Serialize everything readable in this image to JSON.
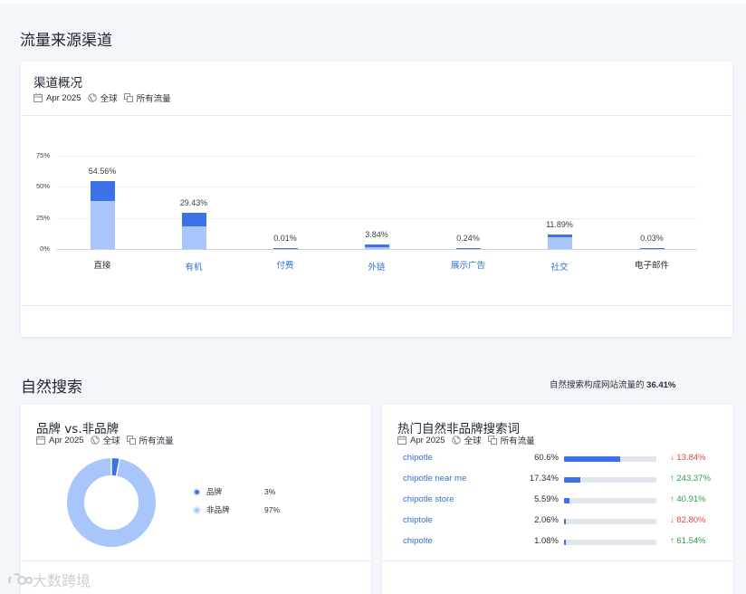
{
  "traffic": {
    "section_title": "流量来源渠道",
    "card_title": "渠道概况",
    "meta": {
      "date": "Apr 2025",
      "region": "全球",
      "traffic_type": "所有流量"
    },
    "chart_data": {
      "type": "bar",
      "stacked": true,
      "y_ticks": [
        "75%",
        "50%",
        "25%",
        "0%"
      ],
      "ylim": [
        0,
        75
      ],
      "categories": [
        "直接",
        "有机",
        "付费",
        "外链",
        "展示广告",
        "社交",
        "电子邮件"
      ],
      "category_link_style": [
        false,
        true,
        true,
        true,
        true,
        true,
        false
      ],
      "values": [
        54.56,
        29.43,
        0.01,
        3.84,
        0.24,
        11.89,
        0.03
      ],
      "value_labels": [
        "54.56%",
        "29.43%",
        "0.01%",
        "3.84%",
        "0.24%",
        "11.89%",
        "0.03%"
      ],
      "light_segment_values": [
        38.9,
        18.4,
        0.5,
        1.7,
        0.5,
        9.3,
        0.5
      ],
      "colors": {
        "light": "#a8c6fb",
        "dark": "#3b72e8"
      },
      "grid": true,
      "legend": "none"
    }
  },
  "organic": {
    "section_title": "自然搜索",
    "share_note_prefix": "自然搜索构成网站流量的",
    "share_note_value": "36.41%",
    "brand_card": {
      "title": "品牌 vs.非品牌",
      "meta": {
        "date": "Apr 2025",
        "region": "全球",
        "traffic_type": "所有流量"
      },
      "chart_data": {
        "type": "pie",
        "donut": true,
        "categories": [
          "品牌",
          "非品牌"
        ],
        "values": [
          3,
          97
        ],
        "value_labels": [
          "3%",
          "97%"
        ],
        "colors": [
          "#3b72e8",
          "#a8c6fb"
        ]
      }
    },
    "keywords_card": {
      "title": "热门自然非品牌搜索词",
      "meta": {
        "date": "Apr 2025",
        "region": "全球",
        "traffic_type": "所有流量"
      },
      "rows": [
        {
          "keyword": "chipotle",
          "share": "60.6%",
          "share_value": 60.6,
          "change": "13.84%",
          "direction": "down"
        },
        {
          "keyword": "chipotle near me",
          "share": "17.34%",
          "share_value": 17.34,
          "change": "243.37%",
          "direction": "up"
        },
        {
          "keyword": "chipotle store",
          "share": "5.59%",
          "share_value": 5.59,
          "change": "40.91%",
          "direction": "up"
        },
        {
          "keyword": "chiptole",
          "share": "2.06%",
          "share_value": 2.06,
          "change": "82.80%",
          "direction": "down"
        },
        {
          "keyword": "chipolte",
          "share": "1.08%",
          "share_value": 1.08,
          "change": "61.54%",
          "direction": "up"
        }
      ]
    }
  },
  "watermark": {
    "text": "大数跨境"
  },
  "icons": {
    "date": "calendar-icon",
    "region": "globe-icon",
    "traffic": "traffic-icon"
  }
}
